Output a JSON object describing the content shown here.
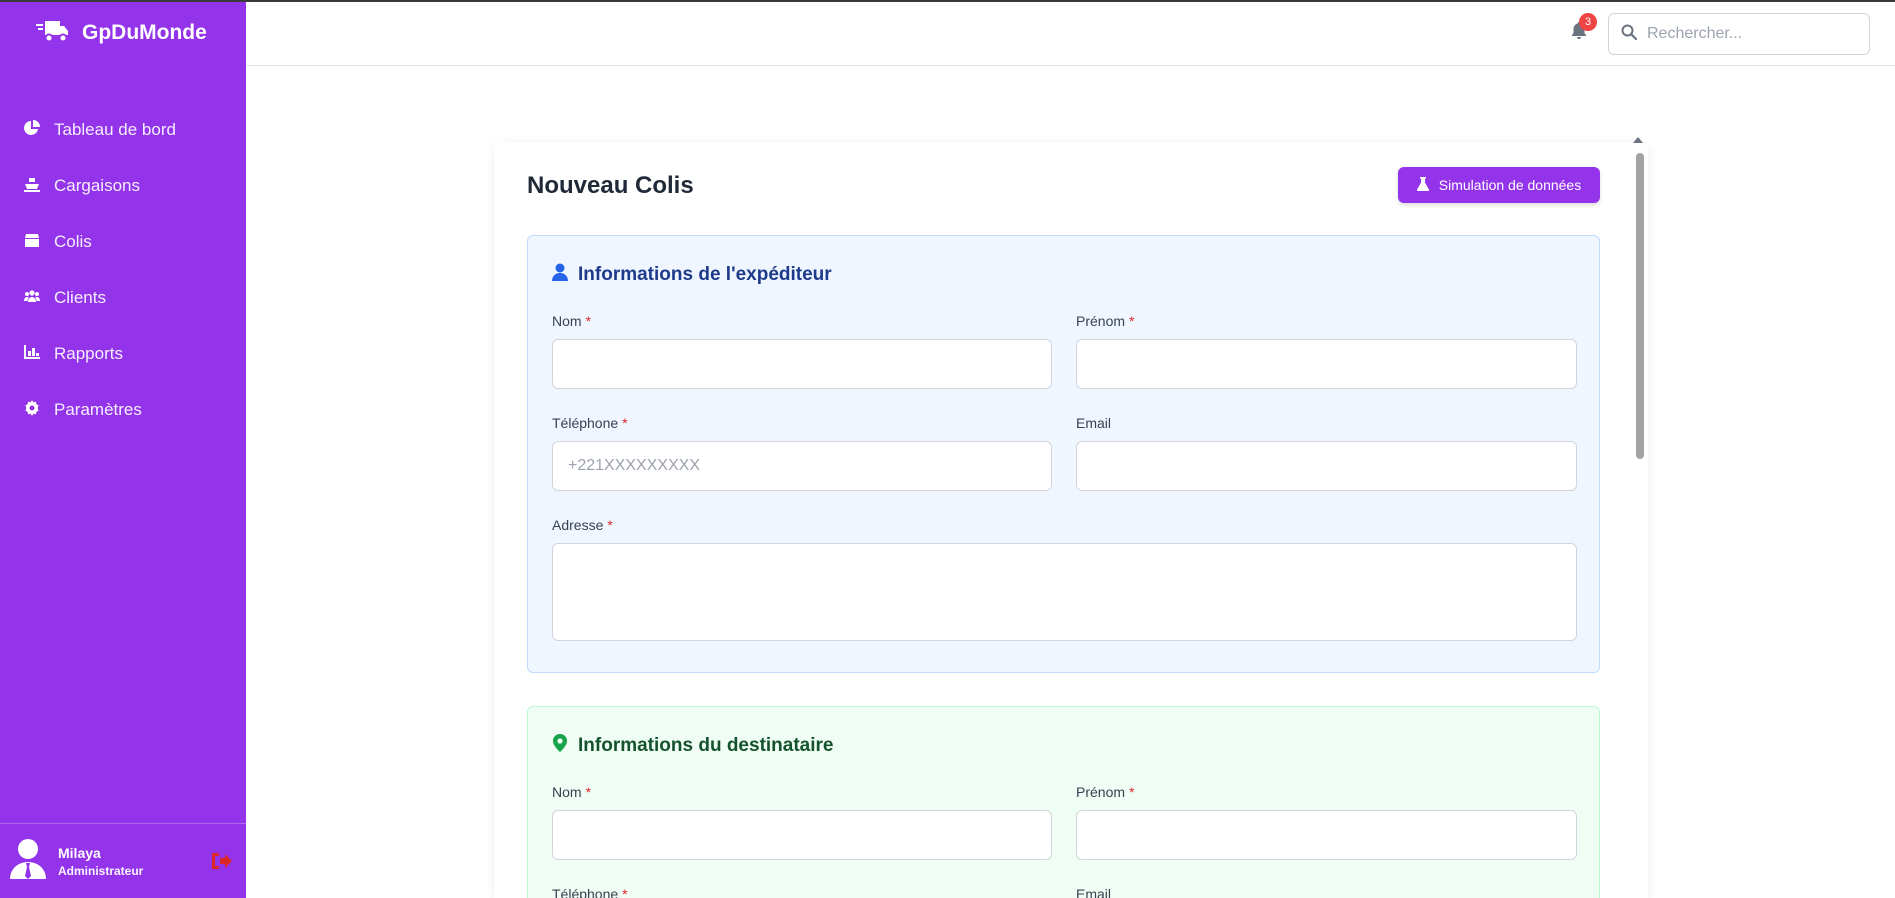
{
  "brand": {
    "name": "GpDuMonde"
  },
  "sidebar": {
    "items": [
      {
        "label": "Tableau de bord",
        "icon": "chart-pie-icon"
      },
      {
        "label": "Cargaisons",
        "icon": "ship-icon"
      },
      {
        "label": "Colis",
        "icon": "box-icon"
      },
      {
        "label": "Clients",
        "icon": "users-icon"
      },
      {
        "label": "Rapports",
        "icon": "chart-bar-icon"
      },
      {
        "label": "Paramètres",
        "icon": "gear-icon"
      }
    ],
    "user": {
      "name": "Milaya",
      "role": "Administrateur"
    }
  },
  "header": {
    "notification_count": "3",
    "search_placeholder": "Rechercher..."
  },
  "page": {
    "title": "Nouveau Colis",
    "simulate_label": "Simulation de données"
  },
  "sender": {
    "title": "Informations de l'expéditeur",
    "nom_label": "Nom",
    "prenom_label": "Prénom",
    "telephone_label": "Téléphone",
    "telephone_placeholder": "+221XXXXXXXXX",
    "email_label": "Email",
    "adresse_label": "Adresse",
    "required_mark": "*"
  },
  "recipient": {
    "title": "Informations du destinataire",
    "nom_label": "Nom",
    "prenom_label": "Prénom",
    "telephone_label": "Téléphone",
    "email_label": "Email",
    "required_mark": "*"
  },
  "colors": {
    "sidebar": "#9333ea",
    "accent": "#9333ea",
    "sender_bg": "#eff6ff",
    "recipient_bg": "#f0fdf4",
    "required": "#dc2626",
    "badge": "#ef4444"
  }
}
